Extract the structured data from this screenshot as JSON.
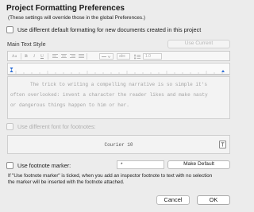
{
  "dialog": {
    "title": "Project Formatting Preferences",
    "subtitle": "(These settings will override those in the global Preferences.)"
  },
  "default_formatting": {
    "checkbox_label": "Use different default formatting for new documents created in this project",
    "checked": false
  },
  "main_text_style": {
    "label": "Main Text Style",
    "use_current_label": "Use Current"
  },
  "toolbar": {
    "font_icon": "Aa",
    "bold": "B",
    "italic": "I",
    "underline": "U",
    "align_left": "align-left-icon",
    "align_center": "align-center-icon",
    "align_right": "align-right-icon",
    "align_justify": "align-justify-icon",
    "style_select": "style-select-icon",
    "color_label": "abc",
    "line_spacing_icon": "line-spacing-icon",
    "line_spacing_value": "1.0"
  },
  "sample": {
    "lines": [
      "The trick to writing a compelling narrative is so simple it's",
      "often overlooked: invent a character the reader likes and make nasty",
      "or dangerous things happen to him or her."
    ]
  },
  "footnotes": {
    "checkbox_label": "Use different font for footnotes:",
    "checked": false,
    "font_display": "Courier 10",
    "font_picker_icon": "font-picker-icon"
  },
  "footnote_marker": {
    "checkbox_label": "Use footnote marker:",
    "checked": false,
    "marker_value": "*",
    "make_default_label": "Make Default",
    "note_lines": [
      "If \"Use footnote marker\" is ticked, when you add an inspector footnote to text with no selection",
      "the marker will be inserted with the footnote attached."
    ]
  },
  "buttons": {
    "cancel": "Cancel",
    "ok": "OK"
  },
  "colors": {
    "background": "#ececec",
    "disabled_text": "#b0b0b0",
    "ruler_marker": "#2f6fd6"
  }
}
